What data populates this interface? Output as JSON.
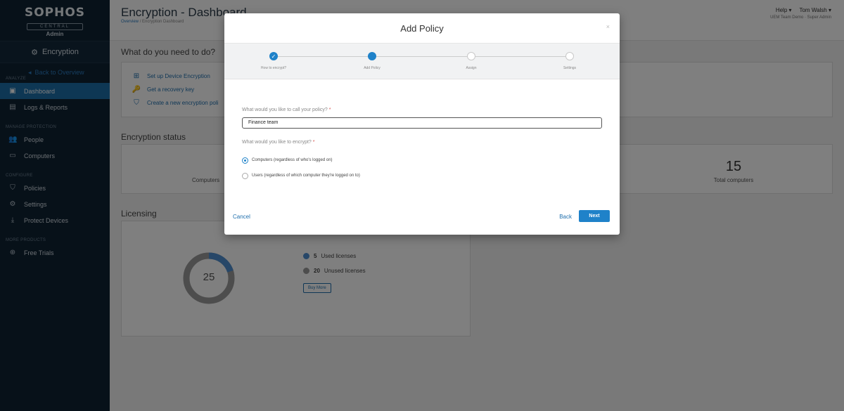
{
  "sidebar": {
    "brand": "SOPHOS",
    "brand_sub": "CENTRAL",
    "brand_role": "Admin",
    "module": "Encryption",
    "back_link": "Back to Overview",
    "sections": {
      "analyze": "ANALYZE",
      "manage": "MANAGE PROTECTION",
      "configure": "CONFIGURE",
      "more": "MORE PRODUCTS"
    },
    "items": {
      "dashboard": "Dashboard",
      "logs": "Logs & Reports",
      "people": "People",
      "computers": "Computers",
      "policies": "Policies",
      "settings": "Settings",
      "protect": "Protect Devices",
      "trials": "Free Trials"
    }
  },
  "header": {
    "title": "Encryption - Dashboard",
    "crumb_overview": "Overview",
    "crumb_sep": "/",
    "crumb_current": "Encryption Dashboard",
    "help": "Help",
    "user": "Tom Walsh",
    "user_sub": "UEM Team Demo · Super Admin"
  },
  "page": {
    "todo_heading": "What do you need to do?",
    "tasks": {
      "setup": "Set up Device Encryption",
      "recovery": "Get a recovery key",
      "create": "Create a new encryption poli"
    },
    "status_heading": "Encryption status",
    "computers_label": "Computers",
    "total_value": "15",
    "total_label": "Total computers",
    "licensing_heading": "Licensing",
    "donut_value": "25",
    "used_count": "5",
    "used_label": "Used licenses",
    "unused_count": "20",
    "unused_label": "Unused licenses",
    "buy_more": "Buy More"
  },
  "modal": {
    "title": "Add Policy",
    "close": "×",
    "steps": [
      {
        "label": "How to encrypt?",
        "state": "done"
      },
      {
        "label": "Add Policy",
        "state": "current"
      },
      {
        "label": "Assign",
        "state": "todo"
      },
      {
        "label": "Settings",
        "state": "todo"
      }
    ],
    "name_question": "What would you like to call your policy?",
    "required_mark": "*",
    "name_value": "Finance team",
    "encrypt_question": "What would you like to encrypt?",
    "options": {
      "computers": "Computers (regardless of who's logged on)",
      "users": "Users (regardless of which computer they're logged on to)"
    },
    "selected_option": "computers",
    "cancel": "Cancel",
    "back": "Back",
    "next": "Next"
  },
  "colors": {
    "accent": "#1f82c9",
    "sidebar_bg": "#0f2233",
    "active_nav": "#1d6fa8",
    "required": "#d9534f"
  }
}
